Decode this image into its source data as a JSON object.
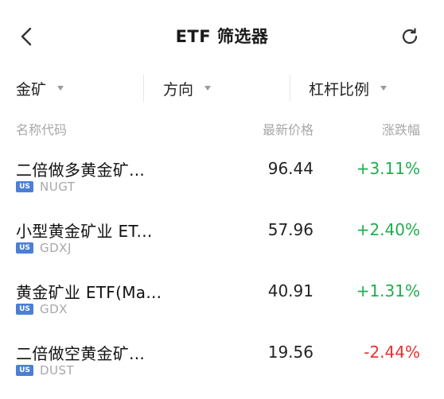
{
  "header": {
    "title": "ETF 筛选器",
    "back_icon": "chevron-left-icon",
    "refresh_icon": "refresh-icon"
  },
  "filters": [
    {
      "label": "金矿"
    },
    {
      "label": "方向"
    },
    {
      "label": "杠杆比例"
    }
  ],
  "columns": {
    "name": "名称代码",
    "price": "最新价格",
    "change": "涨跌幅"
  },
  "rows": [
    {
      "name": "二倍做多黄金矿...",
      "market": "US",
      "ticker": "NUGT",
      "price": "96.44",
      "change": "+3.11%",
      "direction": "up"
    },
    {
      "name": "小型黄金矿业 ET...",
      "market": "US",
      "ticker": "GDXJ",
      "price": "57.96",
      "change": "+2.40%",
      "direction": "up"
    },
    {
      "name": "黄金矿业 ETF(Ma...",
      "market": "US",
      "ticker": "GDX",
      "price": "40.91",
      "change": "+1.31%",
      "direction": "up"
    },
    {
      "name": "二倍做空黄金矿...",
      "market": "US",
      "ticker": "DUST",
      "price": "19.56",
      "change": "-2.44%",
      "direction": "down"
    }
  ],
  "colors": {
    "up": "#1fae4e",
    "down": "#e6322f",
    "badge": "#4b7fd6"
  }
}
